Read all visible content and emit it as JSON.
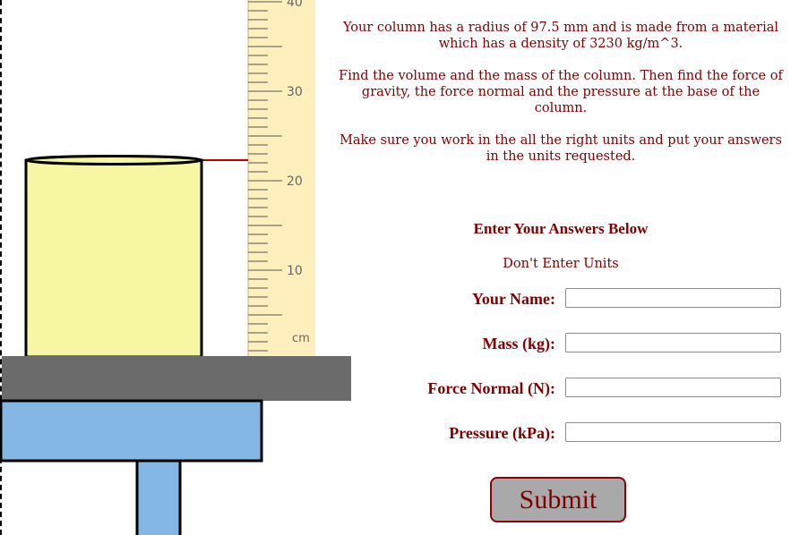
{
  "ruler": {
    "unit_label": "cm",
    "ticks": [
      "40",
      "30",
      "20",
      "10"
    ],
    "column_height_reading_cm": 22
  },
  "column": {
    "radius_mm": 97.5
  },
  "instructions": {
    "line1": "Your column has a radius of 97.5 mm and is made from a material which has a density of 3230 kg/m^3.",
    "line2": "Find the volume and the mass of the column. Then find the force of gravity, the force normal and the pressure at the base of the column.",
    "line3": "Make sure you work in the all the right units and put your answers in the units requested."
  },
  "form": {
    "heading": "Enter Your Answers Below",
    "note": "Don't Enter Units",
    "name_label": "Your Name:",
    "name_value": "",
    "mass_label": "Mass (kg):",
    "mass_value": "",
    "force_label": "Force Normal (N):",
    "force_value": "",
    "pressure_label": "Pressure (kPa):",
    "pressure_value": "",
    "submit_label": "Submit"
  },
  "colors": {
    "text": "#800000",
    "ruler": "#ffefbd",
    "column": "#f7f7a3",
    "platform": "#6b6b6b",
    "table": "#85b7e5",
    "indicator": "#b30000"
  }
}
